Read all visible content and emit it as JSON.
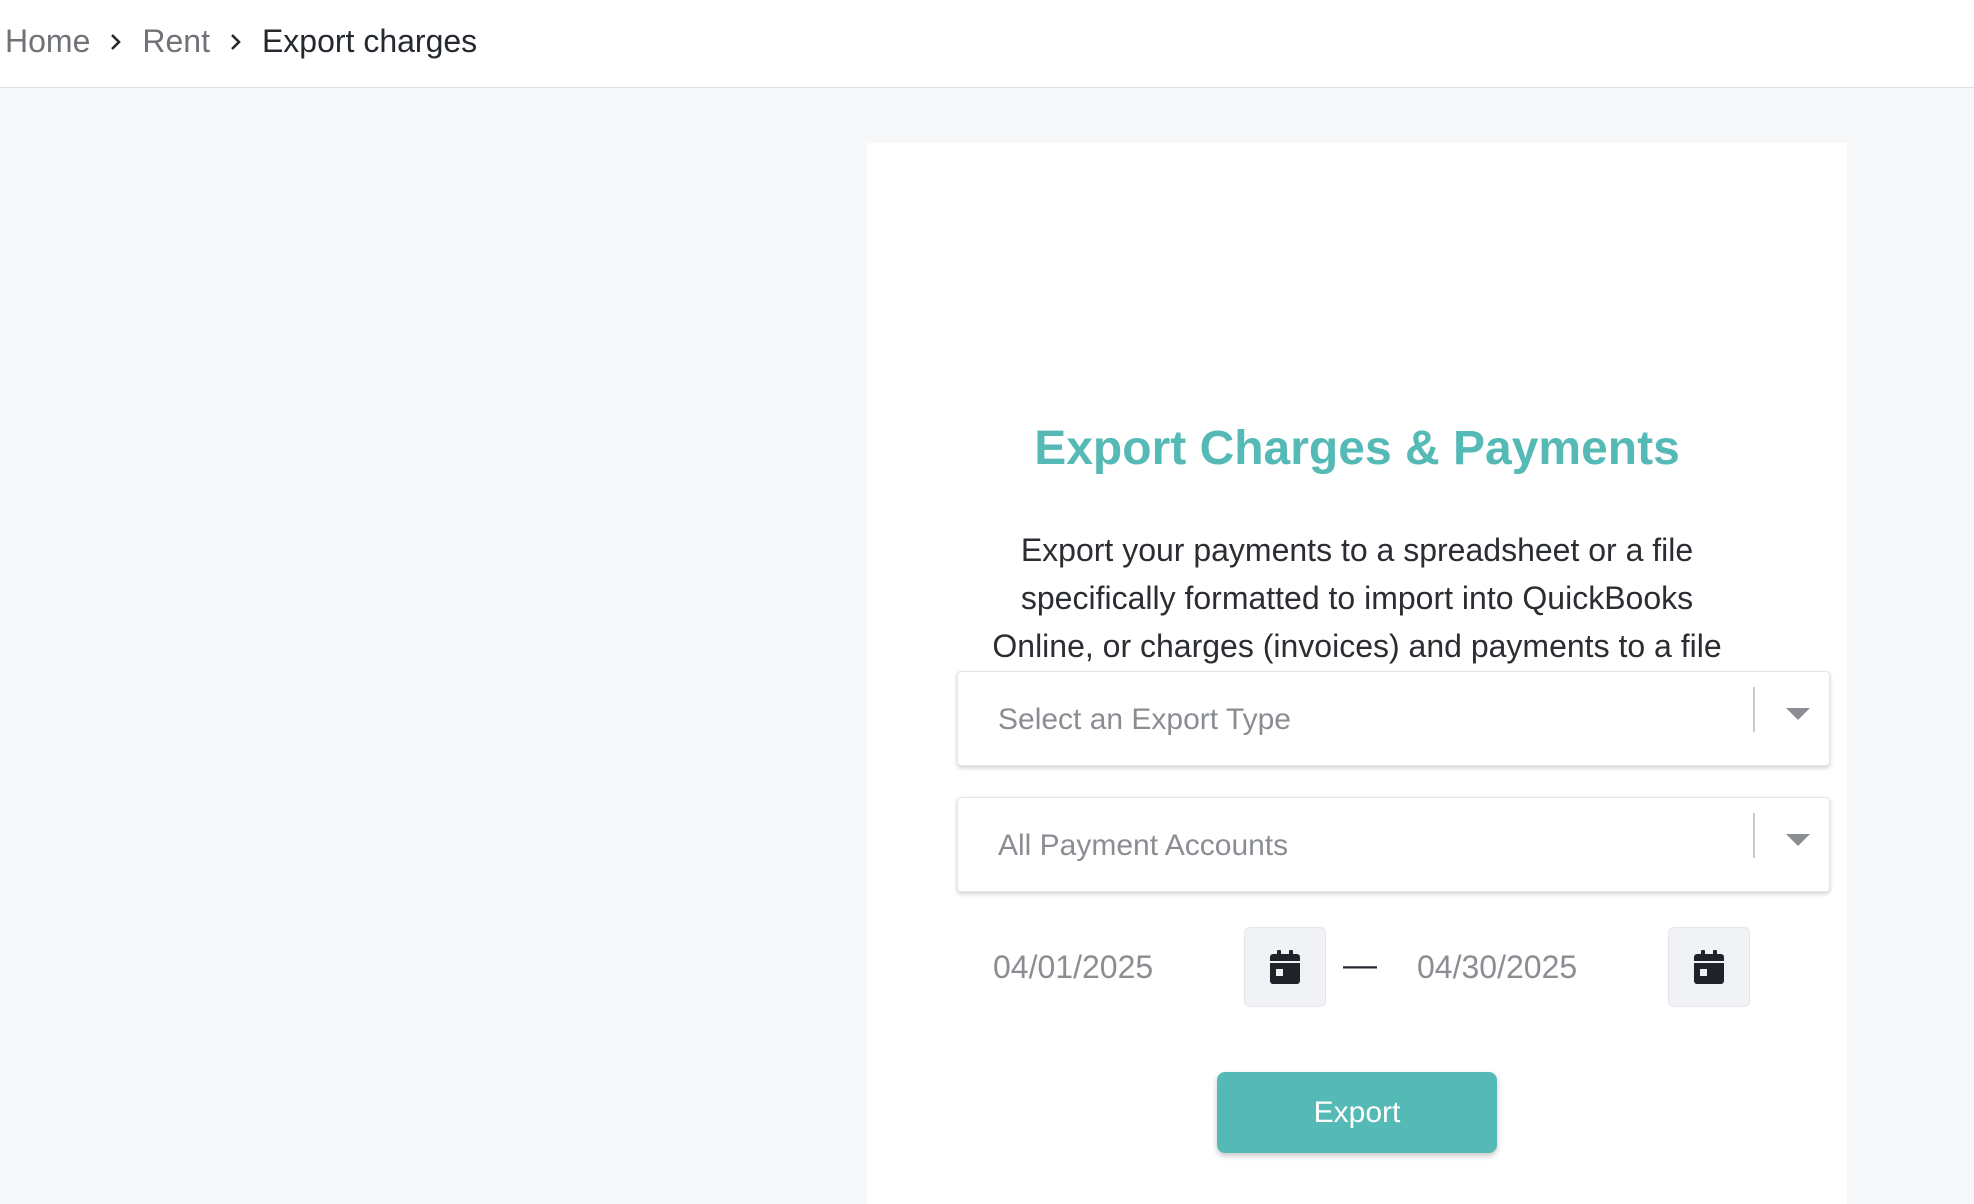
{
  "breadcrumb": {
    "items": [
      {
        "label": "Home"
      },
      {
        "label": "Rent"
      },
      {
        "label": "Export charges"
      }
    ]
  },
  "card": {
    "title": "Export Charges & Payments",
    "description": "Export your payments to a spreadsheet or a file specifically formatted to import into QuickBooks Online, or charges (invoices) and payments to a file specifically formatted to import to Quickbooks Desktop/Pro, or Quickbooks Enterprise!"
  },
  "export_type_select": {
    "placeholder": "Select an Export Type",
    "icon": "chevron-down-icon"
  },
  "payment_accounts_select": {
    "value": "All Payment Accounts",
    "icon": "chevron-down-icon"
  },
  "date_range": {
    "start": "04/01/2025",
    "end": "04/30/2025",
    "separator": "—",
    "icon": "calendar-icon"
  },
  "export_button": {
    "label": "Export"
  },
  "colors": {
    "accent": "#55b9b5",
    "page_background": "#f7f8fa",
    "placeholder_text": "#8a8e93"
  }
}
